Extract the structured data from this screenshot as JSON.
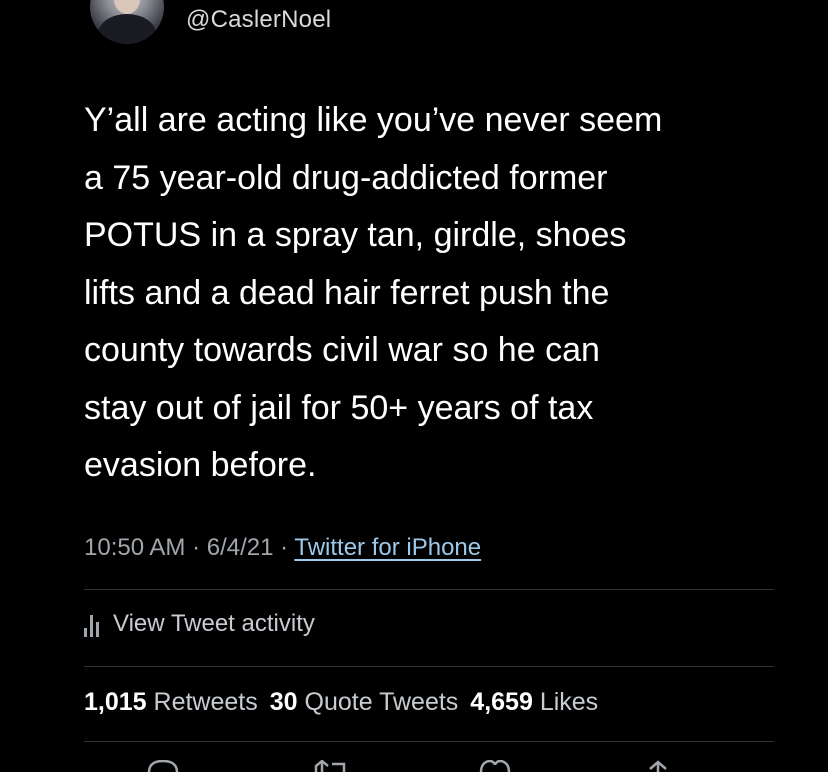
{
  "author": {
    "handle": "@CaslerNoel"
  },
  "tweet": {
    "text": "Y’all are acting like you’ve never seem\na 75 year-old drug-addicted former\nPOTUS in a spray tan, girdle, shoes\nlifts and a dead hair ferret push the\ncounty towards civil war so he can\nstay out of jail for 50+ years of tax\nevasion before.",
    "time": "10:50 AM",
    "date": "6/4/21",
    "separator": " · ",
    "source": "Twitter for iPhone"
  },
  "activity": {
    "label": "View Tweet activity",
    "icon": "bar-chart-icon"
  },
  "stats": {
    "retweets_count": "1,015",
    "retweets_label": "Retweets",
    "quotes_count": "30",
    "quotes_label": "Quote Tweets",
    "likes_count": "4,659",
    "likes_label": "Likes"
  },
  "actions": {
    "reply_icon": "reply-icon",
    "retweet_icon": "retweet-icon",
    "like_icon": "heart-icon",
    "share_icon": "share-icon"
  },
  "colors": {
    "background": "#000000",
    "text": "#ffffff",
    "muted": "#a0a6ab",
    "link": "#9cc9ea",
    "divider": "#2f3336"
  }
}
